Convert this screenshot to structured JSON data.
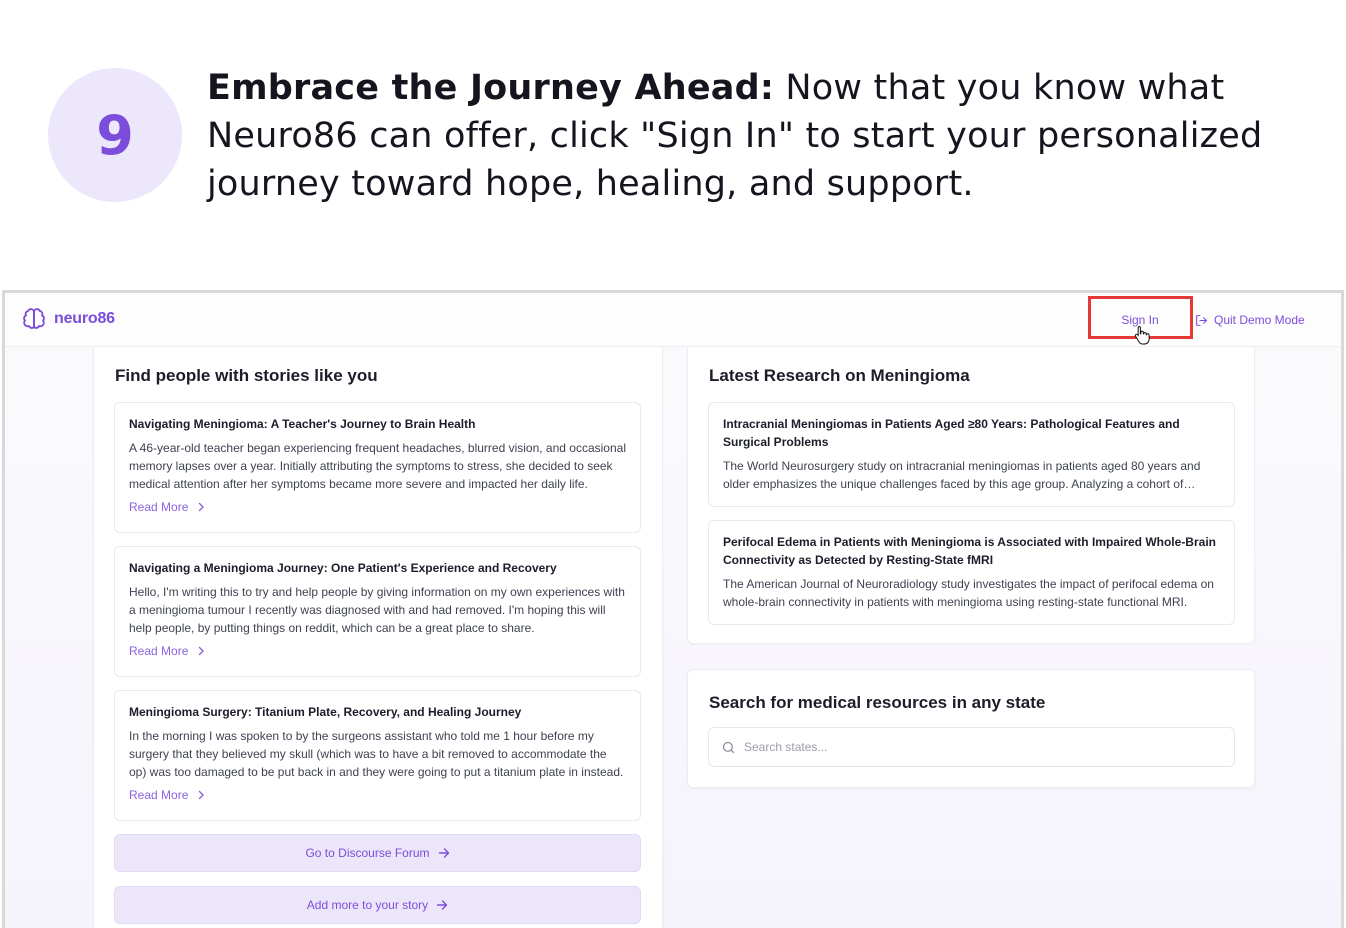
{
  "step": {
    "number": "9",
    "heading": "Embrace the Journey Ahead:",
    "text": " Now that you know what Neuro86 can offer, click \"Sign In\" to start your personalized journey toward hope, healing, and support."
  },
  "app": {
    "brand": "neuro86",
    "nav": {
      "sign_in": "Sign In",
      "quit_demo": "Quit Demo Mode"
    },
    "stories": {
      "title": "Find people with stories like you",
      "items": [
        {
          "title": "Navigating Meningioma: A Teacher's Journey to Brain Health",
          "body": "A 46-year-old teacher began experiencing frequent headaches, blurred vision, and occasional memory lapses over a year. Initially attributing the symptoms to stress, she decided to seek medical attention after her symptoms became more severe and impacted her daily life.",
          "link": "Read More"
        },
        {
          "title": "Navigating a Meningioma Journey: One Patient's Experience and Recovery",
          "body": "Hello, I'm writing this to try and help people by giving information on my own experiences with a meningioma tumour I recently was diagnosed with and had removed. I'm hoping this will help people, by putting things on reddit, which can be a great place to share.",
          "link": "Read More"
        },
        {
          "title": "Meningioma Surgery: Titanium Plate, Recovery, and Healing Journey",
          "body": "In the morning I was spoken to by the surgeons assistant who told me 1 hour before my surgery that they believed my skull (which was to have a bit removed to accommodate the op) was too damaged to be put back in and they were going to put a titanium plate in instead.",
          "link": "Read More"
        }
      ],
      "forum_button": "Go to Discourse Forum",
      "story_button": "Add more to your story"
    },
    "research": {
      "title": "Latest Research on Meningioma",
      "items": [
        {
          "title": "Intracranial Meningiomas in Patients Aged ≥80 Years: Pathological Features and Surgical Problems",
          "body": "The World Neurosurgery study on intracranial meningiomas in patients aged 80 years and older emphasizes the unique challenges faced by this age group. Analyzing a cohort of patients treated surgically."
        },
        {
          "title": "Perifocal Edema in Patients with Meningioma is Associated with Impaired Whole-Brain Connectivity as Detected by Resting-State fMRI",
          "body": "The American Journal of Neuroradiology study investigates the impact of perifocal edema on whole-brain connectivity in patients with meningioma using resting-state functional MRI."
        }
      ]
    },
    "resources": {
      "title": "Search for medical resources in any state",
      "search_placeholder": "Search states..."
    },
    "colors": {
      "accent": "#7c4ddb",
      "accent_light": "#ece6fb",
      "highlight": "#e53935"
    }
  }
}
